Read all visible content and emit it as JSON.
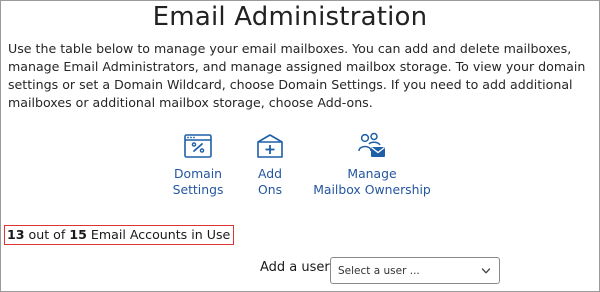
{
  "page": {
    "title": "Email Administration",
    "description": "Use the table below to manage your email mailboxes. You can add and delete mailboxes, manage Email Administrators, and manage assigned mailbox storage. To view your domain settings or set a Domain Wildcard, choose Domain Settings. If you need to add additional mailboxes or additional mailbox storage, choose Add-ons."
  },
  "actions": [
    {
      "line1": "Domain",
      "line2": "Settings",
      "icon": "domain-settings-icon"
    },
    {
      "line1": "Add",
      "line2": "Ons",
      "icon": "add-ons-icon"
    },
    {
      "line1": "Manage",
      "line2": "Mailbox Ownership",
      "icon": "mailbox-ownership-icon"
    }
  ],
  "usage": {
    "used": "13",
    "mid": "out of",
    "total": "15",
    "suffix": "Email Accounts in Use"
  },
  "add_user": {
    "label": "Add a user",
    "placeholder": "Select a user ..."
  },
  "colors": {
    "accent": "#2456a0",
    "highlight_border": "#dd3333"
  }
}
